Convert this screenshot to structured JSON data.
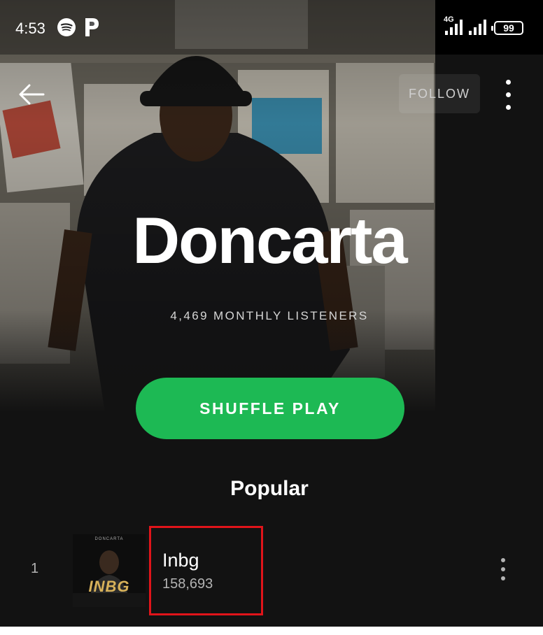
{
  "status_bar": {
    "time": "4:53",
    "network_label": "4G",
    "battery_level": "99",
    "icons": [
      "spotify-icon",
      "p-icon",
      "signal-icon",
      "battery-icon"
    ]
  },
  "nav": {
    "back_icon": "arrow-left-icon",
    "follow_label": "FOLLOW",
    "more_icon": "vertical-dots-icon"
  },
  "artist": {
    "name": "Doncarta",
    "monthly_listeners": "4,469 MONTHLY LISTENERS"
  },
  "actions": {
    "shuffle_label": "SHUFFLE PLAY"
  },
  "popular": {
    "title": "Popular",
    "tracks": [
      {
        "rank": "1",
        "title": "Inbg",
        "plays": "158,693",
        "art_top_text": "DONCARTA",
        "art_word": "INBG"
      }
    ]
  },
  "colors": {
    "background": "#121212",
    "accent": "#1db954",
    "highlight": "#e0141a",
    "secondary_text": "#b3b3b3"
  }
}
